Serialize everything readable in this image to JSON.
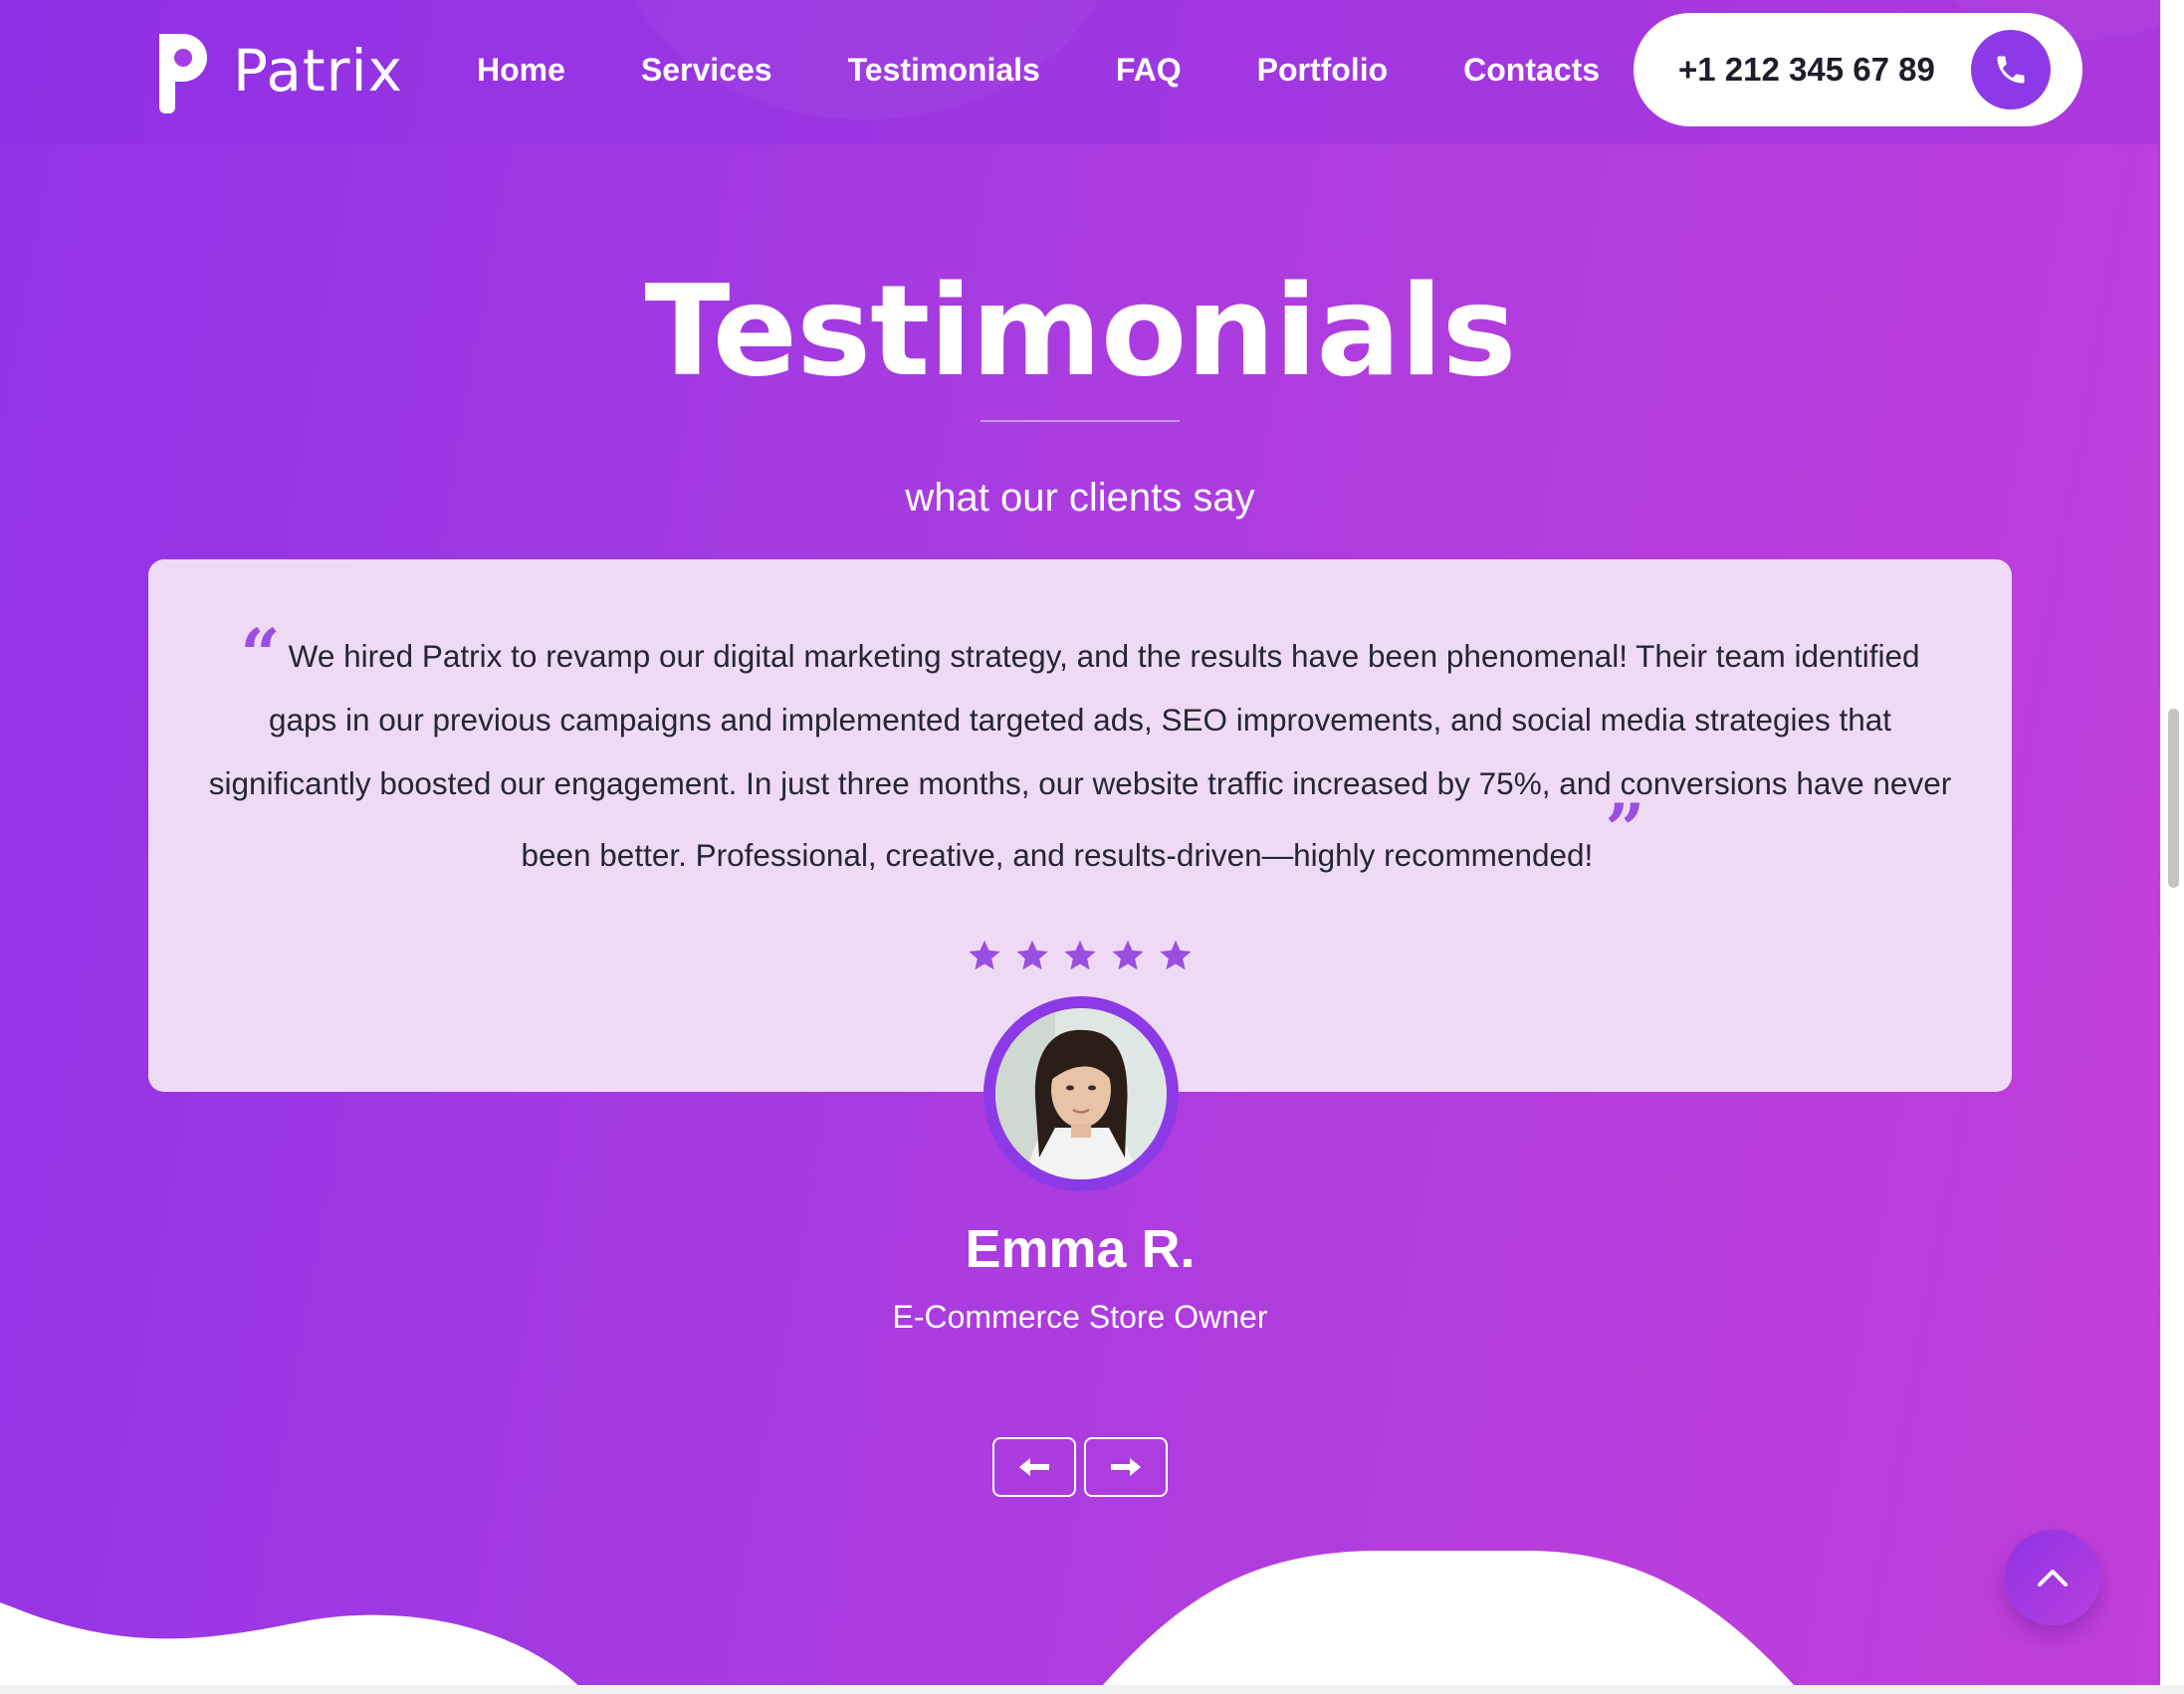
{
  "header": {
    "logo_text": "Patrix",
    "nav": [
      {
        "label": "Home"
      },
      {
        "label": "Services"
      },
      {
        "label": "Testimonials"
      },
      {
        "label": "FAQ"
      },
      {
        "label": "Portfolio"
      },
      {
        "label": "Contacts"
      }
    ],
    "phone": "+1 212 345 67 89"
  },
  "section": {
    "title": "Testimonials",
    "subtitle": "what our clients say"
  },
  "testimonial": {
    "quote": "We hired Patrix to revamp our digital marketing strategy, and the results have been phenomenal! Their team identified gaps in our previous campaigns and implemented targeted ads, SEO improvements, and social media strategies that significantly boosted our engagement. In just three months, our website traffic increased by 75%, and conversions have never been better. Professional, creative, and results-driven—highly recommended!",
    "rating": 5,
    "rating_max": 5,
    "name": "Emma R.",
    "role": "E-Commerce Store Owner"
  },
  "icons": {
    "phone": "phone-icon",
    "prev": "arrow-left-icon",
    "next": "arrow-right-icon",
    "scroll_top": "chevron-up-icon",
    "star": "star-icon",
    "quote_open": "quote-open-icon",
    "quote_close": "quote-close-icon"
  },
  "colors": {
    "gradient_start": "#9133e6",
    "gradient_end": "#c23fd9",
    "card_bg": "#efdaf5",
    "accent": "#8c3ae8",
    "star": "#9a4fe0"
  }
}
